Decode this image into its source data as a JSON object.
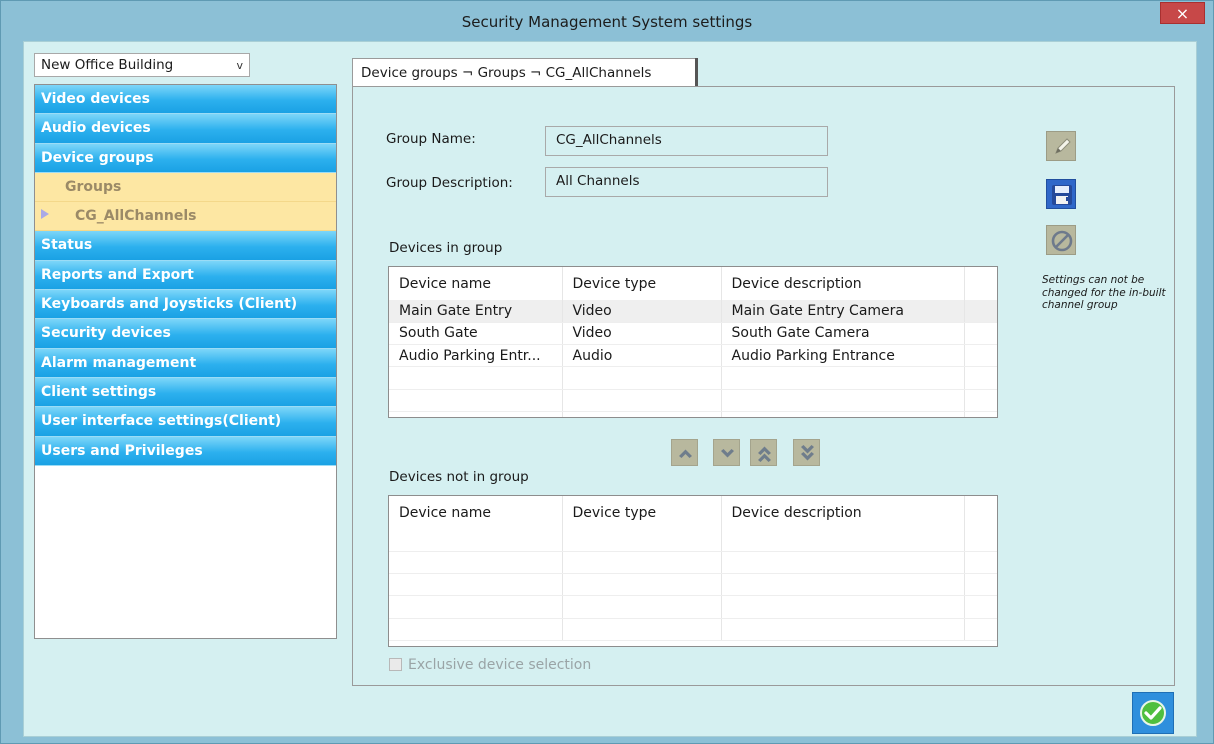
{
  "window": {
    "title": "Security Management System settings",
    "close_glyph": "×"
  },
  "site_select": {
    "value": "New Office Building",
    "chevron": "v"
  },
  "nav": {
    "items": [
      {
        "label": "Video devices",
        "kind": "section"
      },
      {
        "label": "Audio devices",
        "kind": "section"
      },
      {
        "label": "Device groups",
        "kind": "section"
      },
      {
        "label": "Groups",
        "kind": "sub1"
      },
      {
        "label": "CG_AllChannels",
        "kind": "sub2"
      },
      {
        "label": "Status",
        "kind": "section"
      },
      {
        "label": "Reports and Export",
        "kind": "section"
      },
      {
        "label": "Keyboards and Joysticks (Client)",
        "kind": "section"
      },
      {
        "label": "Security devices",
        "kind": "section"
      },
      {
        "label": "Alarm management",
        "kind": "section"
      },
      {
        "label": "Client settings",
        "kind": "section"
      },
      {
        "label": "User interface settings(Client)",
        "kind": "section"
      },
      {
        "label": "Users and Privileges",
        "kind": "section"
      }
    ]
  },
  "tab": {
    "label": "Device groups ¬ Groups ¬ CG_AllChannels"
  },
  "form": {
    "group_name_label": "Group Name:",
    "group_name_value": "CG_AllChannels",
    "group_description_label": "Group Description:",
    "group_description_value": "All Channels"
  },
  "devices_in_group": {
    "title": "Devices in group",
    "columns": [
      "Device name",
      "Device type",
      "Device description"
    ],
    "rows": [
      [
        "Main Gate Entry",
        "Video",
        "Main Gate Entry Camera"
      ],
      [
        "South Gate",
        "Video",
        "South Gate Camera"
      ],
      [
        "Audio Parking Entr...",
        "Audio",
        "Audio Parking Entrance"
      ]
    ]
  },
  "devices_not_in_group": {
    "title": "Devices not in group",
    "columns": [
      "Device name",
      "Device type",
      "Device description"
    ],
    "rows": []
  },
  "side_note": "Settings can not be changed for the in-built channel group",
  "exclusive_label": "Exclusive device selection",
  "icons": {
    "edit": "pencil-icon",
    "save": "floppy-icon",
    "cancel": "no-entry-icon",
    "move_up": "chevron-up-icon",
    "move_down": "chevron-down-icon",
    "move_all_up": "double-chevron-up-icon",
    "move_all_down": "double-chevron-down-icon",
    "ok": "checkmark-icon"
  },
  "colors": {
    "nav_blue": "#2cb0ee",
    "nav_sub_bg": "#fde7a3",
    "client_bg": "#d5f0f1",
    "close_red": "#c74848"
  }
}
